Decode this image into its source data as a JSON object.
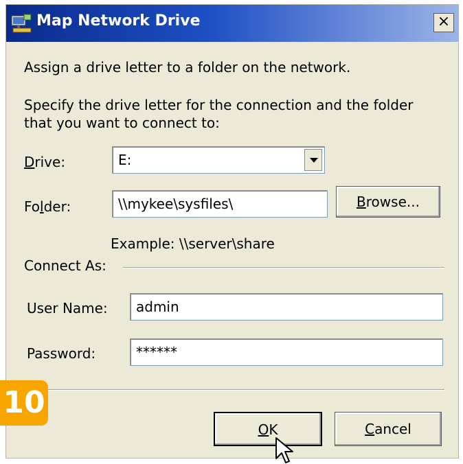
{
  "window": {
    "title": "Map Network Drive",
    "close_label": "×"
  },
  "intro": "Assign a drive letter to a folder on the network.",
  "instructions_line1": "Specify the drive letter for the connection and the folder",
  "instructions_line2": "that you want to connect to:",
  "drive": {
    "label_prefix": "",
    "label_underline": "D",
    "label_suffix": "rive:",
    "value": "E:"
  },
  "folder": {
    "label_prefix": "Fo",
    "label_underline": "l",
    "label_suffix": "der:",
    "value": "\\\\mykee\\sysfiles\\"
  },
  "browse_button": {
    "underline": "B",
    "rest": "rowse..."
  },
  "example": "Example: \\\\server\\share",
  "connect_as": "Connect As:",
  "username": {
    "label": "User Name:",
    "value": "admin"
  },
  "password": {
    "label": "Password:",
    "value": "******"
  },
  "ok_button": {
    "underline": "O",
    "rest": "K"
  },
  "cancel_button": {
    "underline": "C",
    "rest": "ancel"
  },
  "step_badge": "10",
  "colors": {
    "title_bar": "#1e4fc4",
    "dialog_bg": "#ece9d6",
    "badge": "#f7a600"
  }
}
